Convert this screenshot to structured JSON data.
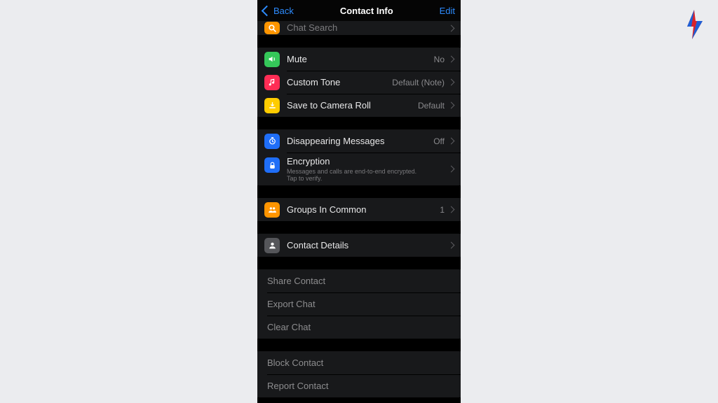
{
  "nav": {
    "back": "Back",
    "title": "Contact Info",
    "edit": "Edit"
  },
  "rows": {
    "chat_search": {
      "label": "Chat Search"
    },
    "mute": {
      "label": "Mute",
      "value": "No"
    },
    "custom_tone": {
      "label": "Custom Tone",
      "value": "Default (Note)"
    },
    "save_camera": {
      "label": "Save to Camera Roll",
      "value": "Default"
    },
    "disappearing": {
      "label": "Disappearing Messages",
      "value": "Off"
    },
    "encryption": {
      "label": "Encryption",
      "sub": "Messages and calls are end-to-end encrypted. Tap to verify."
    },
    "groups": {
      "label": "Groups In Common",
      "value": "1"
    },
    "contact_details": {
      "label": "Contact Details"
    },
    "share": {
      "label": "Share Contact"
    },
    "export": {
      "label": "Export Chat"
    },
    "clear": {
      "label": "Clear Chat"
    },
    "block": {
      "label": "Block Contact"
    },
    "report": {
      "label": "Report Contact"
    }
  }
}
